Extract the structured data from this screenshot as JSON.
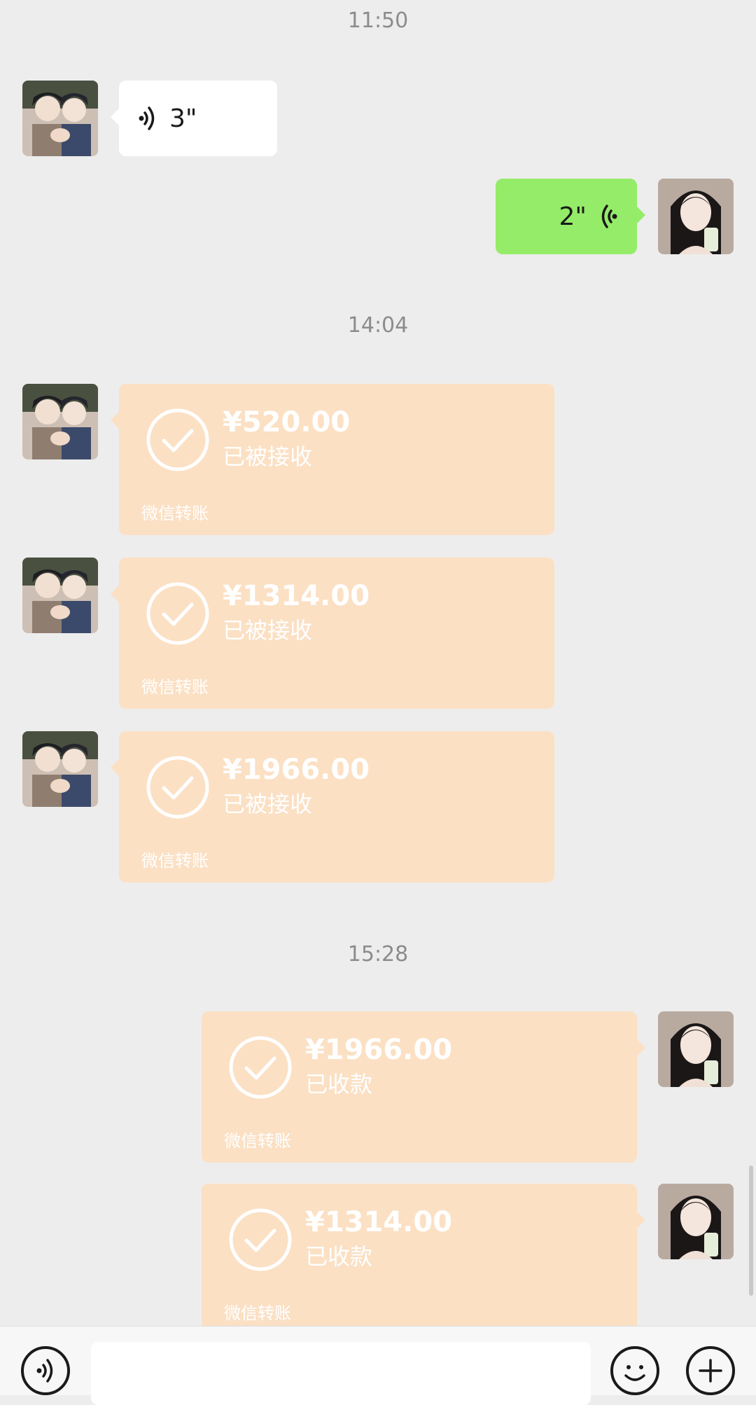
{
  "messages": [
    {
      "time": "11:50"
    },
    {
      "voice_left": "3\""
    },
    {
      "voice_right": "2\""
    },
    {
      "time": "14:04"
    }
  ],
  "times": {
    "t1": "11:50",
    "t2": "14:04",
    "t3": "15:28"
  },
  "voice": {
    "left_duration": "3\"",
    "right_duration": "2\""
  },
  "transfers": [
    {
      "amount": "¥520.00",
      "status": "已被接收",
      "footer": "微信转账"
    },
    {
      "amount": "¥1314.00",
      "status": "已被接收",
      "footer": "微信转账"
    },
    {
      "amount": "¥1966.00",
      "status": "已被接收",
      "footer": "微信转账"
    },
    {
      "amount": "¥1966.00",
      "status": "已收款",
      "footer": "微信转账"
    },
    {
      "amount": "¥1314.00",
      "status": "已收款",
      "footer": "微信转账"
    }
  ],
  "colors": {
    "background": "#ededed",
    "voice_out": "#95ec69",
    "voice_in": "#ffffff",
    "transfer": "#fbe0c4"
  },
  "icons": [
    "voice-wave-icon",
    "check-circle-icon",
    "voice-input-icon",
    "emoji-icon",
    "add-icon"
  ]
}
